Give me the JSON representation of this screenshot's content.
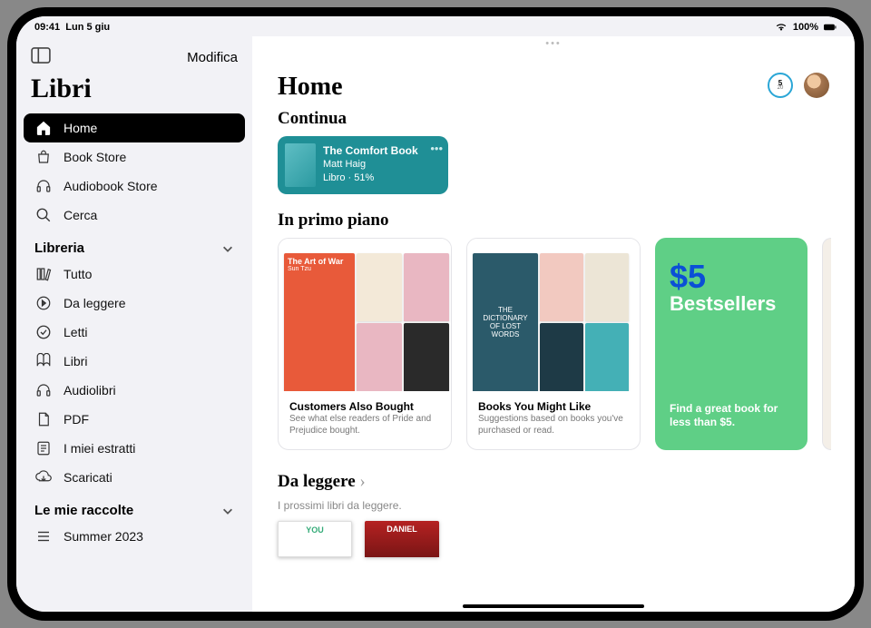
{
  "status": {
    "time": "09:41",
    "date": "Lun 5 giu",
    "battery": "100%"
  },
  "sidebar": {
    "edit": "Modifica",
    "title": "Libri",
    "nav": [
      {
        "label": "Home"
      },
      {
        "label": "Book Store"
      },
      {
        "label": "Audiobook Store"
      },
      {
        "label": "Cerca"
      }
    ],
    "library_header": "Libreria",
    "library": [
      {
        "label": "Tutto"
      },
      {
        "label": "Da leggere"
      },
      {
        "label": "Letti"
      },
      {
        "label": "Libri"
      },
      {
        "label": "Audiolibri"
      },
      {
        "label": "PDF"
      },
      {
        "label": "I miei estratti"
      },
      {
        "label": "Scaricati"
      }
    ],
    "collections_header": "Le mie raccolte",
    "collections": [
      {
        "label": "Summer 2023"
      }
    ]
  },
  "header": {
    "title": "Home",
    "goal_top": "5",
    "goal_bottom": "20"
  },
  "continue": {
    "section": "Continua",
    "title": "The Comfort Book",
    "author": "Matt Haig",
    "progress": "Libro · 51%"
  },
  "featured": {
    "section": "In primo piano",
    "cards": [
      {
        "title": "Customers Also Bought",
        "desc": "See what else readers of Pride and Prejudice bought."
      },
      {
        "title": "Books You Might Like",
        "desc": "Suggestions based on books you've purchased or read."
      }
    ],
    "green": {
      "price": "$5",
      "label": "Bestsellers",
      "tag": "Find a great book for less than $5."
    }
  },
  "spines1": [
    {
      "t": "The Art of War",
      "a": "Sun Tzu"
    }
  ],
  "to_read": {
    "section": "Da leggere",
    "sub": "I prossimi libri da leggere."
  },
  "to_read_books": [
    {
      "label": "YOU"
    },
    {
      "label": "DANIEL"
    }
  ]
}
